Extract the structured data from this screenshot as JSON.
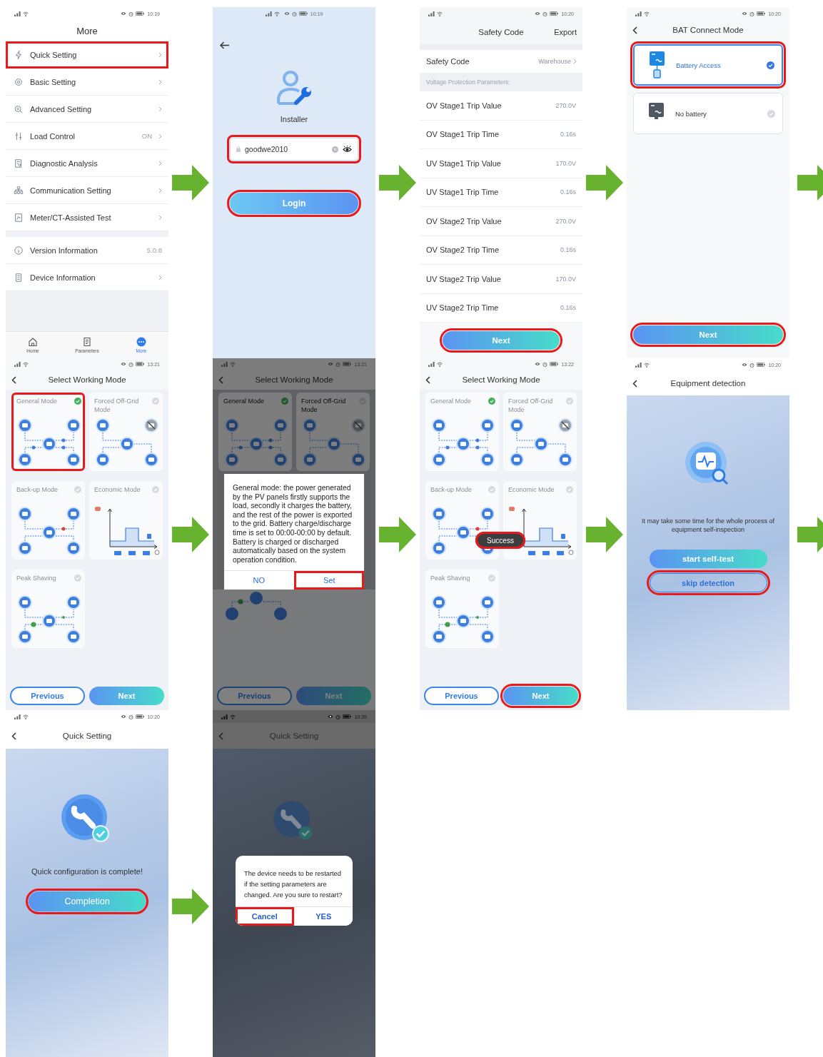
{
  "screens": [
    {
      "kind": "menu",
      "status_time": "10:19",
      "title": "More",
      "sections": [
        {
          "items": [
            {
              "label": "Quick Setting",
              "chevron": true,
              "highlighted": true
            },
            {
              "label": "Basic Setting",
              "chevron": true,
              "highlighted": false
            },
            {
              "label": "Advanced Setting",
              "chevron": true,
              "highlighted": false
            },
            {
              "label": "Load Control",
              "value": "ON",
              "chevron": true,
              "highlighted": false
            },
            {
              "label": "Diagnostic Analysis",
              "chevron": true,
              "highlighted": false
            },
            {
              "label": "Communication Setting",
              "chevron": true,
              "highlighted": false
            },
            {
              "label": "Meter/CT-Assisted Test",
              "chevron": true,
              "highlighted": false
            }
          ]
        },
        {
          "items": [
            {
              "label": "Version Information",
              "value": "5.0.8",
              "chevron": false,
              "highlighted": false
            },
            {
              "label": "Device Information",
              "chevron": true,
              "highlighted": false
            }
          ]
        }
      ],
      "nav": [
        {
          "label": "Home",
          "selected": false
        },
        {
          "label": "Parameters",
          "selected": false
        },
        {
          "label": "More",
          "selected": true
        }
      ]
    },
    {
      "kind": "login",
      "status_time": "10:19",
      "role": "Installer",
      "password": {
        "value": "goodwe2010",
        "highlighted": true
      },
      "button": {
        "label": "Login",
        "highlighted": true
      }
    },
    {
      "kind": "safety_code",
      "status_time": "10:20",
      "title": "Safety Code",
      "action": "Export",
      "safety_code": {
        "label": "Safety Code",
        "value": "Warehouse"
      },
      "section_label": "Voltage Protection Parameters:",
      "params": [
        {
          "label": "OV Stage1 Trip Value",
          "value": "270.0V"
        },
        {
          "label": "OV Stage1 Trip Time",
          "value": "0.16s"
        },
        {
          "label": "UV Stage1 Trip Value",
          "value": "170.0V"
        },
        {
          "label": "UV Stage1 Trip Time",
          "value": "0.16s"
        },
        {
          "label": "OV Stage2 Trip Value",
          "value": "270.0V"
        },
        {
          "label": "OV Stage2 Trip Time",
          "value": "0.16s"
        },
        {
          "label": "UV Stage2 Trip Value",
          "value": "170.0V"
        },
        {
          "label": "UV Stage2 Trip Time",
          "value": "0.16s"
        }
      ],
      "button": {
        "label": "Next",
        "highlighted": true
      }
    },
    {
      "kind": "bat_mode",
      "status_time": "10:20",
      "title": "BAT Connect Mode",
      "options": [
        {
          "label": "Battery Access",
          "selected": true,
          "highlighted": true
        },
        {
          "label": "No battery",
          "selected": false,
          "highlighted": false
        }
      ],
      "button": {
        "label": "Next",
        "highlighted": true
      }
    },
    {
      "kind": "working_mode",
      "status_time": "13:21",
      "title": "Select Working Mode",
      "modes": [
        {
          "name": "General Mode",
          "kind": "flow",
          "selected": true,
          "highlighted": true
        },
        {
          "name": "Forced Off-Grid Mode",
          "kind": "offgrid",
          "selected": false,
          "highlighted": false
        },
        {
          "name": "Back-up Mode",
          "kind": "backup",
          "selected": false,
          "highlighted": false
        },
        {
          "name": "Economic Mode",
          "kind": "schedule",
          "selected": false,
          "highlighted": false
        },
        {
          "name": "Peak Shaving",
          "kind": "peak",
          "selected": false,
          "highlighted": false
        }
      ],
      "buttons": [
        {
          "label": "Previous",
          "highlighted": false
        },
        {
          "label": "Next",
          "highlighted": false
        }
      ]
    },
    {
      "kind": "mode_dialog",
      "status_time": "13:21",
      "title": "Select Working Mode",
      "modes": [
        {
          "name": "General Mode",
          "kind": "flow",
          "selected": true,
          "highlighted": false
        },
        {
          "name": "Forced Off-Grid Mode",
          "kind": "offgrid",
          "selected": false,
          "highlighted": false
        }
      ],
      "dialog": {
        "text": "General mode: the power generated by the PV panels firstly supports the load, secondly it charges the battery, and the rest of the power is exported to the grid. Battery charge/discharge time is set to 00:00-00:00 by default. Battery is charged or discharged automatically based on the system operation condition.",
        "buttons": [
          {
            "label": "NO",
            "highlighted": false
          },
          {
            "label": "Set",
            "highlighted": true
          }
        ]
      },
      "buttons": [
        {
          "label": "Previous",
          "highlighted": false
        },
        {
          "label": "Next",
          "highlighted": false
        }
      ]
    },
    {
      "kind": "working_mode",
      "status_time": "13:22",
      "title": "Select Working Mode",
      "modes": [
        {
          "name": "General Mode",
          "kind": "flow",
          "selected": true,
          "highlighted": false
        },
        {
          "name": "Forced Off-Grid Mode",
          "kind": "offgrid",
          "selected": false,
          "highlighted": false
        },
        {
          "name": "Back-up Mode",
          "kind": "backup",
          "selected": false,
          "highlighted": false
        },
        {
          "name": "Economic Mode",
          "kind": "schedule",
          "selected": false,
          "highlighted": false
        },
        {
          "name": "Peak Shaving",
          "kind": "peak",
          "selected": false,
          "highlighted": false
        }
      ],
      "toast": {
        "text": "Success",
        "highlighted": true
      },
      "buttons": [
        {
          "label": "Previous",
          "highlighted": false
        },
        {
          "label": "Next",
          "highlighted": true
        }
      ]
    },
    {
      "kind": "detection",
      "status_time": "10:20",
      "title": "Equipment detection",
      "message": "It may take some time for the whole process of equipment self-inspection",
      "buttons": [
        {
          "label": "start self-test",
          "highlighted": false
        },
        {
          "label": "skip detection",
          "highlighted": true
        }
      ]
    },
    {
      "kind": "completion",
      "status_time": "10:20",
      "title": "Quick Setting",
      "message": "Quick configuration is complete!",
      "button": {
        "label": "Completion",
        "highlighted": true
      }
    },
    {
      "kind": "restart_dialog",
      "status_time": "10:20",
      "title": "Quick Setting",
      "dialog": {
        "text": "The device needs to be restarted if the setting parameters are changed. Are you sure to restart?",
        "buttons": [
          {
            "label": "Cancel",
            "highlighted": true
          },
          {
            "label": "YES",
            "highlighted": false
          }
        ]
      }
    }
  ]
}
